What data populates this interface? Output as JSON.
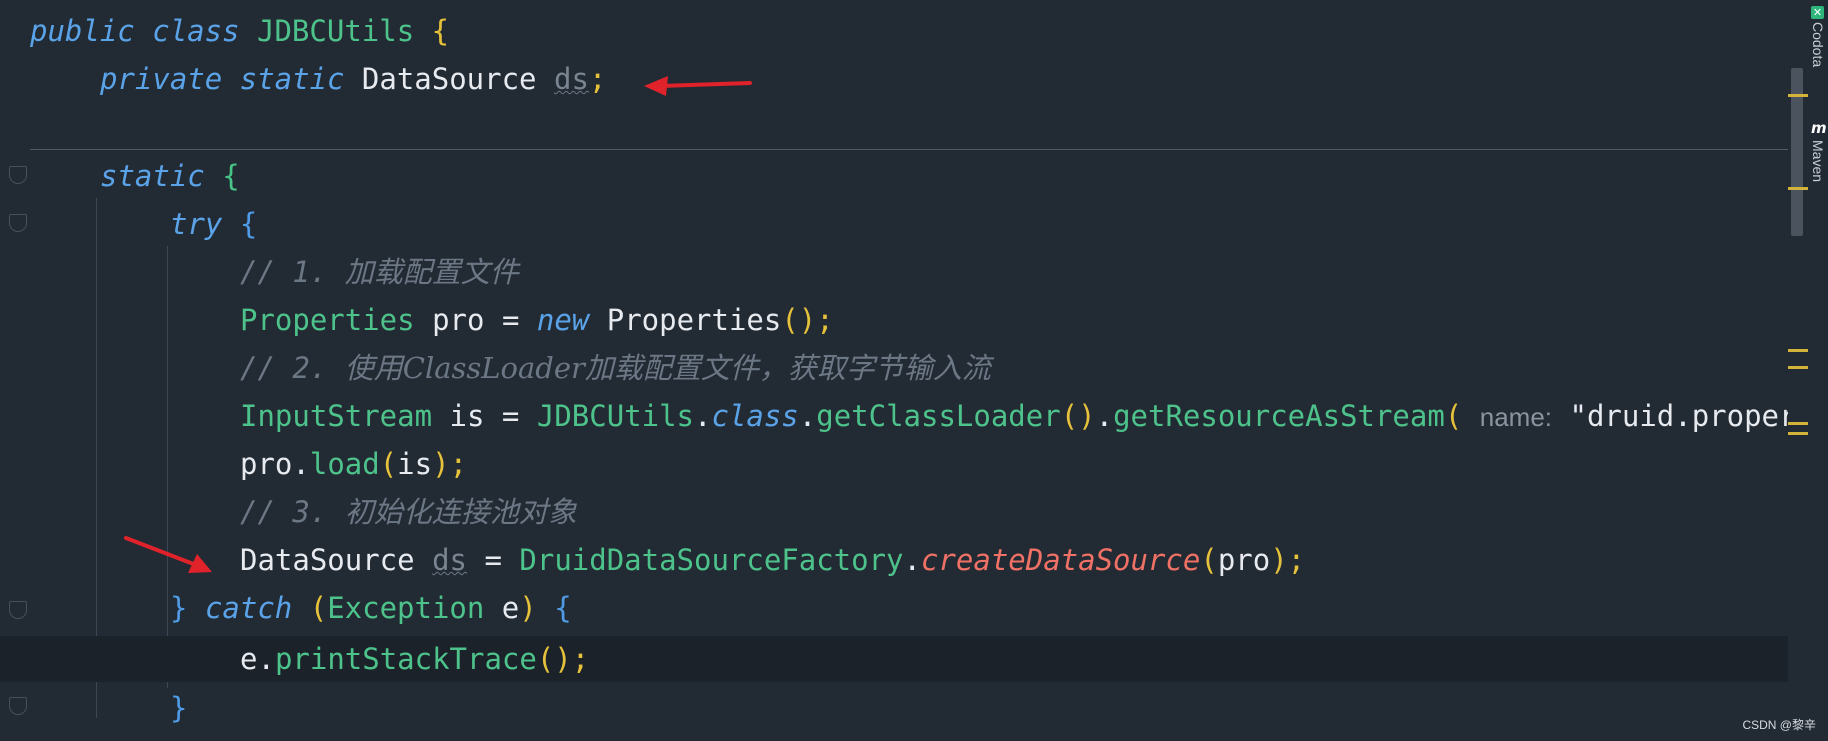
{
  "editor": {
    "class_decl": {
      "kw1": "public",
      "kw2": "class",
      "name": "JDBCUtils",
      "brace": "{"
    },
    "field_decl": {
      "kw1": "private",
      "kw2": "static",
      "type": "DataSource",
      "name": "ds",
      "semi": ";"
    },
    "static_block": {
      "kw": "static",
      "brace": "{"
    },
    "try_stmt": {
      "kw": "try",
      "brace": "{"
    },
    "comment1": {
      "prefix": "// 1. ",
      "text": "加载配置文件"
    },
    "props_line": {
      "type": "Properties",
      "var": "pro",
      "eq": "=",
      "kw": "new",
      "ctor": "Properties",
      "parens": "()",
      "semi": ";"
    },
    "comment2": {
      "prefix": "// 2. ",
      "text": "使用ClassLoader加载配置文件，获取字节输入流"
    },
    "stream_line": {
      "type": "InputStream",
      "var": "is",
      "eq": "=",
      "cls": "JDBCUtils",
      "dot1": ".",
      "kw": "class",
      "dot2": ".",
      "m1": "getClassLoader",
      "p1": "()",
      "dot3": ".",
      "m2": "getResourceAsStream",
      "p2": "(",
      "hint": "name:",
      "str": "\"druid.propert"
    },
    "load_line": {
      "obj": "pro",
      "dot": ".",
      "method": "load",
      "open": "(",
      "arg": "is",
      "close": ")",
      "semi": ";"
    },
    "comment3": {
      "prefix": "// 3. ",
      "text": "初始化连接池对象"
    },
    "ds_line": {
      "type": "DataSource",
      "var": "ds",
      "eq": "=",
      "cls": "DruidDataSourceFactory",
      "dot": ".",
      "method": "createDataSource",
      "open": "(",
      "arg": "pro",
      "close": ")",
      "semi": ";"
    },
    "catch_line": {
      "brace_close": "}",
      "kw": "catch",
      "open": "(",
      "type": "Exception",
      "var": "e",
      "close": ")",
      "brace_open": "{"
    },
    "print_line": {
      "obj": "e",
      "dot": ".",
      "method": "printStackTrace",
      "parens": "()",
      "semi": ";"
    },
    "try_close": {
      "brace": "}"
    }
  },
  "right_panel": {
    "codota_label": "Codota",
    "maven_label": "Maven",
    "maven_icon_letter": "m"
  },
  "watermark": "CSDN @黎辛",
  "colors": {
    "background": "#222a33",
    "current_line": "#1b222a",
    "keyword": "#5aa3e8",
    "class_name": "#4dc38b",
    "comment": "#6c7785",
    "static_call": "#f07165",
    "brace_yellow": "#e6c13b",
    "annotation_arrow": "#e0232b"
  }
}
